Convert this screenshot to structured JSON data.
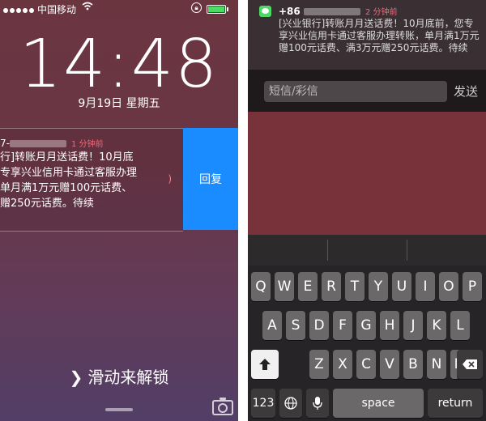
{
  "lock_screen": {
    "status": {
      "carrier": "中国移动",
      "wifi_icon": "wifi-icon",
      "rotation_lock_icon": "rotation-lock-icon",
      "battery_icon": "battery-icon",
      "battery_color": "#4cd964"
    },
    "clock": "14:48",
    "date": "9月19日 星期五",
    "notification": {
      "sender_prefix": "7-",
      "time_ago": "1 分钟前",
      "lines": [
        "行]转账月月送话费！10月底",
        "专享兴业信用卡通过客服办理",
        "单月满1万元赠100元话费、",
        "赠250元话费。待续"
      ]
    },
    "reply_label": "回复",
    "slide_text": "滑动来解锁",
    "slide_arrow": "❯"
  },
  "message_screen": {
    "notification": {
      "app_icon": "messages-icon",
      "sender_prefix": "+86",
      "time_ago": "2 分钟前",
      "body": "[兴业银行]转账月月送话费！10月底前，您专享兴业信用卡通过客服办理转账，单月满1万元赠100元话费、满3万元赠250元话费。待续"
    },
    "input_placeholder": "短信/彩信",
    "send_label": "发送",
    "keyboard": {
      "row1": [
        "Q",
        "W",
        "E",
        "R",
        "T",
        "Y",
        "U",
        "I",
        "O",
        "P"
      ],
      "row2": [
        "A",
        "S",
        "D",
        "F",
        "G",
        "H",
        "J",
        "K",
        "L"
      ],
      "row3": [
        "Z",
        "X",
        "C",
        "V",
        "B",
        "N",
        "M"
      ],
      "shift_icon": "shift-icon",
      "delete_icon": "delete-icon",
      "num_key": "123",
      "globe_icon": "globe-icon",
      "mic_icon": "mic-icon",
      "space_label": "space",
      "return_label": "return"
    }
  }
}
